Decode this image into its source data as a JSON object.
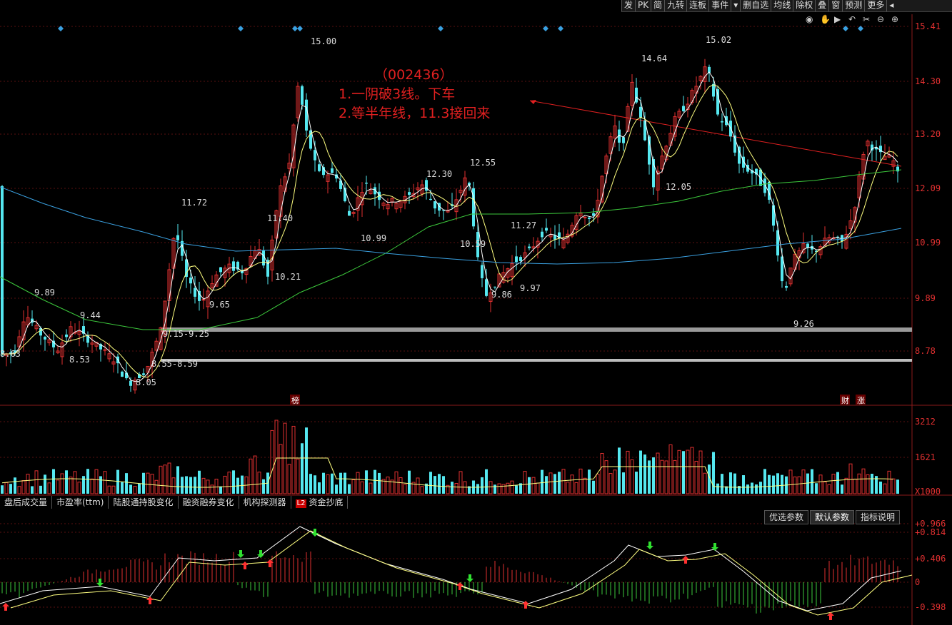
{
  "toolbar": {
    "items": [
      "发",
      "PK",
      "简",
      "九转",
      "连板",
      "事件",
      "▾",
      "删自选",
      "均线",
      "除权",
      "叠",
      "窗",
      "预测",
      "更多",
      "◂"
    ]
  },
  "annotation": {
    "title": "（002436）",
    "line1": "1.一阴破3线。下车",
    "line2": "2.等半年线，11.3接回来"
  },
  "price_axis": [
    "15.41",
    "14.30",
    "13.20",
    "12.09",
    "10.99",
    "9.89",
    "8.78"
  ],
  "price_labels": [
    "15.00",
    "15.02",
    "14.64",
    "12.55",
    "12.30",
    "11.72",
    "11.40",
    "11.27",
    "10.99",
    "10.59",
    "10.21",
    "9.97",
    "9.86",
    "9.89",
    "9.65",
    "9.44",
    "9.26",
    "9.15-9.25",
    "8.55-8.59",
    "8.63",
    "8.53",
    "8.05",
    "12.05"
  ],
  "markers": [
    "榜",
    "财",
    "涨"
  ],
  "volume_axis": [
    "3212",
    "1621",
    "X1000"
  ],
  "bottom_tabs": [
    "盘后成交量",
    "市盈率(ttm)",
    "陆股通持股变化",
    "融资融券变化",
    "机构探测器",
    "L2",
    "资金抄底"
  ],
  "param_buttons": [
    "优选参数",
    "默认参数",
    "指标说明"
  ],
  "indicator_axis": [
    "+0.966",
    "+0.814",
    "+0.406",
    "0",
    "-0.398"
  ],
  "colors": {
    "up": "#e03030",
    "down": "#55e8f0",
    "ma_fast": "#ffffff",
    "ma_mid": "#ffff80",
    "ma60": "#3cc83c",
    "ma_long": "#3aa0e0"
  }
}
